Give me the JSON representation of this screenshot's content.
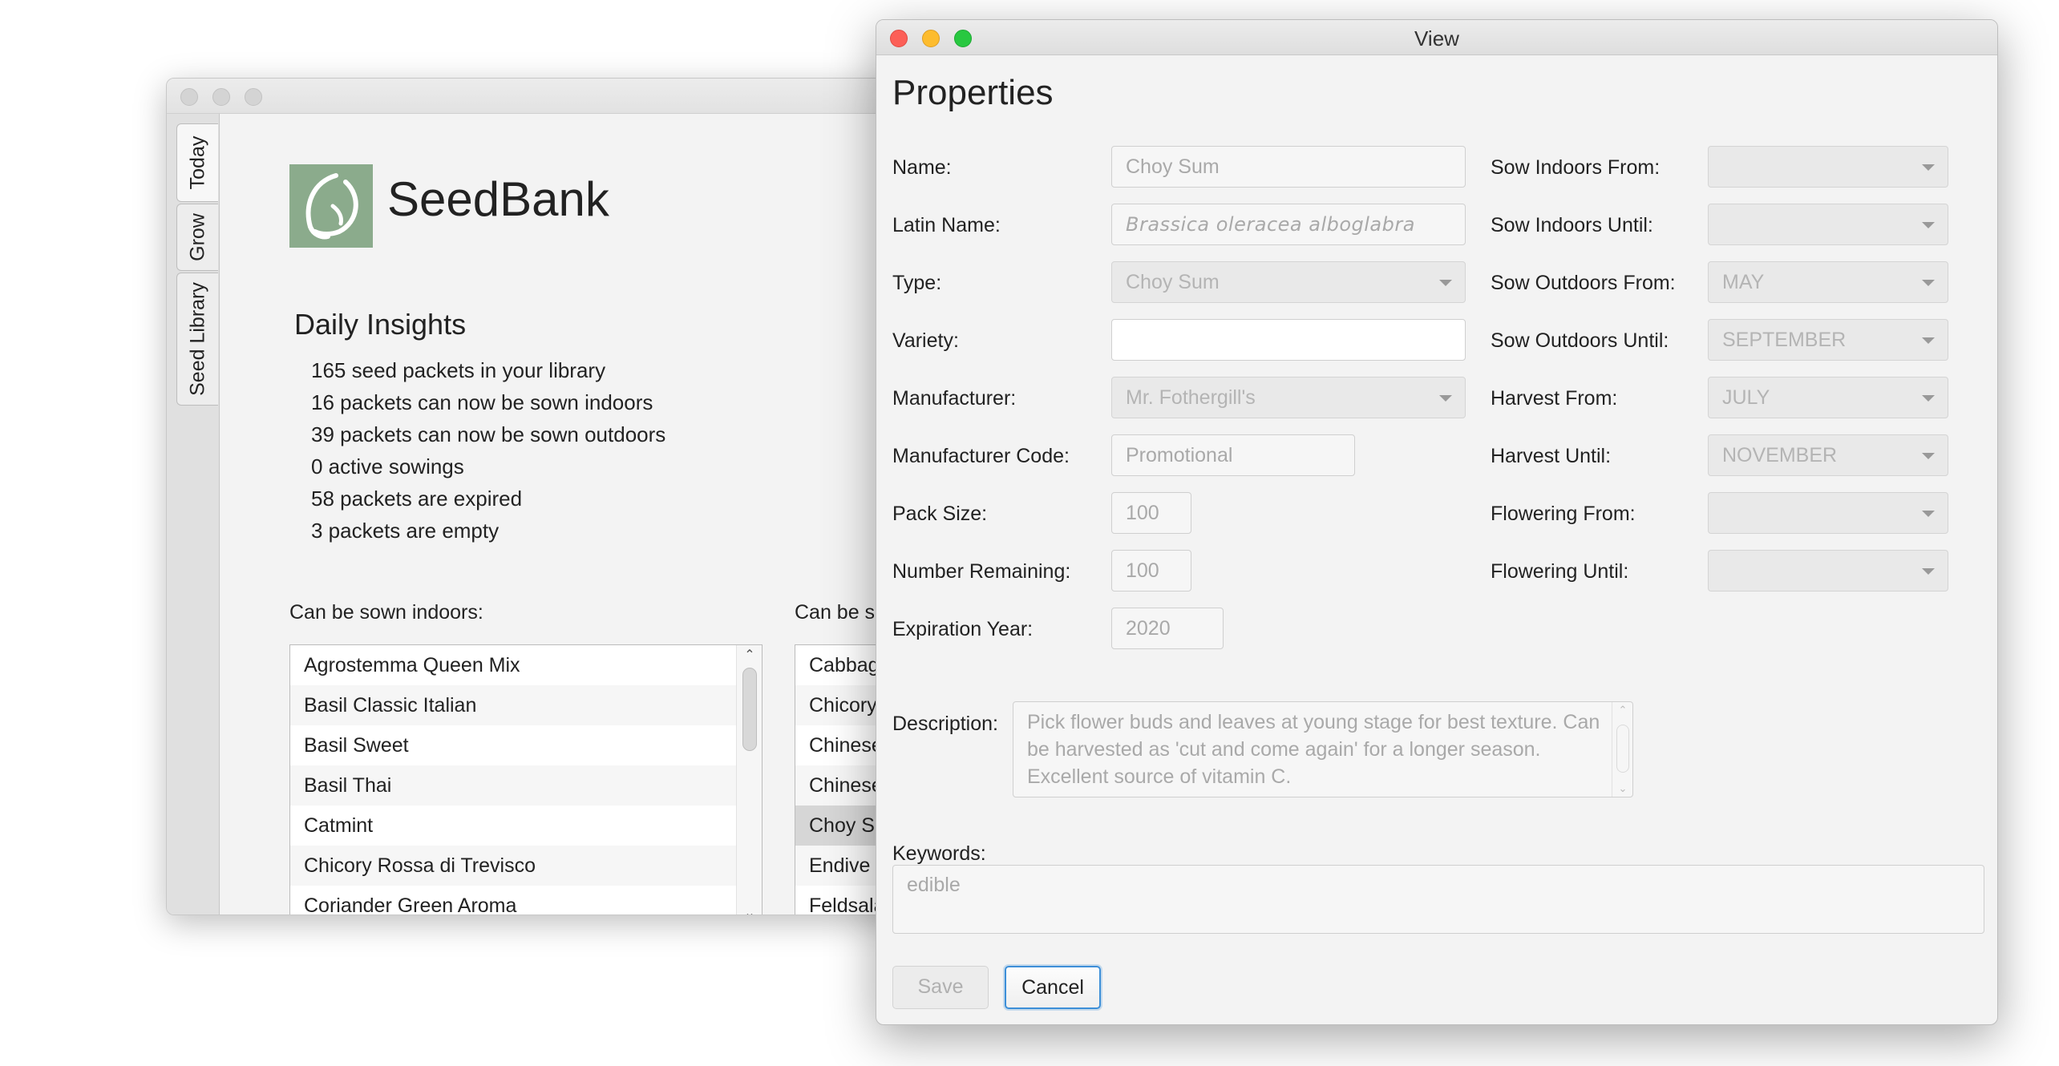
{
  "main_window": {
    "side_tabs": [
      "Today",
      "Grow",
      "Seed Library"
    ],
    "app_title": "SeedBank",
    "insights": {
      "title": "Daily Insights",
      "items": [
        "165 seed packets in your library",
        "16 packets can now be sown indoors",
        "39 packets can now be sown outdoors",
        "0 active sowings",
        "58 packets are expired",
        "3 packets are empty"
      ]
    },
    "indoor": {
      "label": "Can be sown indoors:",
      "items": [
        "Agrostemma Queen Mix",
        "Basil Classic Italian",
        "Basil Sweet",
        "Basil Thai",
        "Catmint",
        "Chicory Rossa  di  Trevisco",
        "Coriander Green Aroma"
      ]
    },
    "outdoor": {
      "label": "Can be sown outdoors:",
      "items": [
        "Cabbage Wheeler's Imperial",
        "Chicory Rossa di Treviso",
        "Chinese Cabbage",
        "Chinese Kale",
        "Choy Sum",
        "Endive Pancalieri",
        "Feldsalat Favor"
      ],
      "selected": "Choy Sum"
    }
  },
  "dialog": {
    "window_title": "View",
    "heading": "Properties",
    "left": {
      "name": {
        "label": "Name:",
        "value": "Choy Sum"
      },
      "latin_name": {
        "label": "Latin Name:",
        "value": "Brassica oleracea alboglabra"
      },
      "type": {
        "label": "Type:",
        "value": "Choy Sum"
      },
      "variety": {
        "label": "Variety:",
        "value": ""
      },
      "manufacturer": {
        "label": "Manufacturer:",
        "value": "Mr. Fothergill's"
      },
      "manufacturer_code": {
        "label": "Manufacturer Code:",
        "value": "Promotional"
      },
      "pack_size": {
        "label": "Pack Size:",
        "value": "100"
      },
      "number_remaining": {
        "label": "Number Remaining:",
        "value": "100"
      },
      "expiration_year": {
        "label": "Expiration Year:",
        "value": "2020"
      }
    },
    "right": {
      "sow_indoors_from": {
        "label": "Sow Indoors From:",
        "value": ""
      },
      "sow_indoors_until": {
        "label": "Sow Indoors Until:",
        "value": ""
      },
      "sow_outdoors_from": {
        "label": "Sow Outdoors From:",
        "value": "MAY"
      },
      "sow_outdoors_until": {
        "label": "Sow Outdoors Until:",
        "value": "SEPTEMBER"
      },
      "harvest_from": {
        "label": "Harvest From:",
        "value": "JULY"
      },
      "harvest_until": {
        "label": "Harvest Until:",
        "value": "NOVEMBER"
      },
      "flowering_from": {
        "label": "Flowering From:",
        "value": ""
      },
      "flowering_until": {
        "label": "Flowering Until:",
        "value": ""
      }
    },
    "description": {
      "label": "Description:",
      "value": "Pick flower buds and leaves at young stage for best texture. Can be harvested as 'cut and come again' for a longer season. Excellent source of vitamin C."
    },
    "keywords": {
      "label": "Keywords:",
      "value": "edible"
    },
    "buttons": {
      "save": "Save",
      "cancel": "Cancel"
    }
  },
  "icons": {
    "logo": "seedbank-leaf-logo",
    "dropdown": "chevron-down-icon",
    "scroll_up": "chevron-up-icon",
    "scroll_down": "chevron-down-icon"
  },
  "colors": {
    "logo_green": "#8bab8c",
    "close": "#fc5f57",
    "minimize": "#fdbc2e",
    "zoom": "#28c840",
    "focus_ring": "#3d8fd8"
  }
}
